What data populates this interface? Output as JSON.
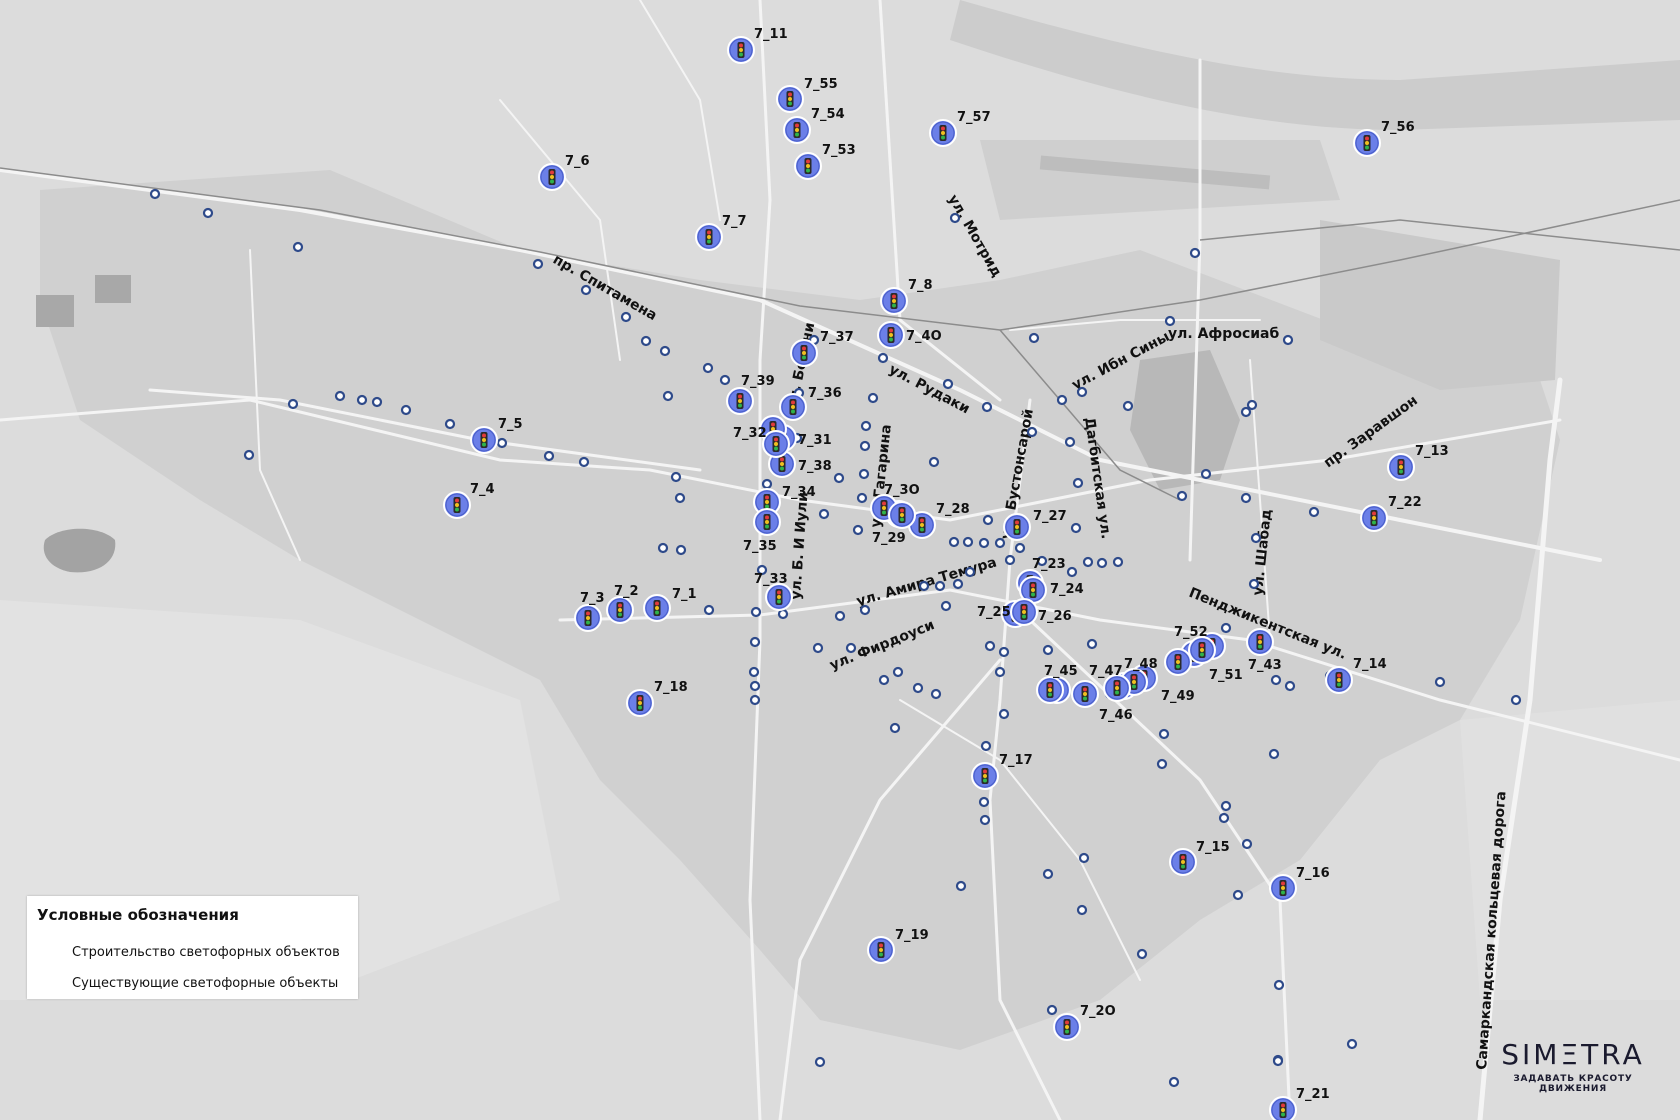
{
  "legend": {
    "title": "Условные обозначения",
    "new_label": "Строительство светофорных объектов",
    "existing_label": "Существующие светофорные объекты"
  },
  "logo": {
    "main": "SIMΞTRA",
    "tagline": "ЗАДАВАТЬ КРАСОТУ ДВИЖЕНИЯ"
  },
  "colors": {
    "new_marker": "#6b7fe8",
    "existing_marker": "#2e4a8a",
    "roads": "#ffffff",
    "background": "#dcdcdc"
  },
  "streets": [
    {
      "id": "spitamena",
      "name": "пр. Спитамена"
    },
    {
      "id": "motrid",
      "name": "ул. Мотрид"
    },
    {
      "id": "beruni",
      "name": "ул. Беруни"
    },
    {
      "id": "rudaki",
      "name": "ул. Рудаки"
    },
    {
      "id": "ibnsiny",
      "name": "ул. Ибн Сины"
    },
    {
      "id": "afrosiab",
      "name": "ул. Афросиаб"
    },
    {
      "id": "zarafshon",
      "name": "пр. Заравшон"
    },
    {
      "id": "gagarina",
      "name": "ул. Гагарина"
    },
    {
      "id": "bustonsaroy",
      "name": "ул. Бустонсарой"
    },
    {
      "id": "dagbitskaya",
      "name": "Дагбитская ул."
    },
    {
      "id": "b9iyuli",
      "name": "ул. Б. И Иули"
    },
    {
      "id": "amiratemura",
      "name": "ул. Амира Темура"
    },
    {
      "id": "firdousi",
      "name": "ул. Фирдоуси"
    },
    {
      "id": "shabad",
      "name": "ул. Шабад"
    },
    {
      "id": "pendzhikent",
      "name": "Пенджикентская ул."
    },
    {
      "id": "ring",
      "name": "Самаркандская кольцевая дорога"
    }
  ],
  "new_objects": [
    {
      "id": "7_1",
      "label": "7_1"
    },
    {
      "id": "7_2",
      "label": "7_2"
    },
    {
      "id": "7_3",
      "label": "7_3"
    },
    {
      "id": "7_4",
      "label": "7_4"
    },
    {
      "id": "7_5",
      "label": "7_5"
    },
    {
      "id": "7_6",
      "label": "7_6"
    },
    {
      "id": "7_7",
      "label": "7_7"
    },
    {
      "id": "7_8",
      "label": "7_8"
    },
    {
      "id": "7_11",
      "label": "7_11"
    },
    {
      "id": "7_13",
      "label": "7_13"
    },
    {
      "id": "7_14",
      "label": "7_14"
    },
    {
      "id": "7_15",
      "label": "7_15"
    },
    {
      "id": "7_16",
      "label": "7_16"
    },
    {
      "id": "7_17",
      "label": "7_17"
    },
    {
      "id": "7_18",
      "label": "7_18"
    },
    {
      "id": "7_19",
      "label": "7_19"
    },
    {
      "id": "7_20",
      "label": "7_2О"
    },
    {
      "id": "7_21",
      "label": "7_21"
    },
    {
      "id": "7_22",
      "label": "7_22"
    },
    {
      "id": "7_23",
      "label": "7_23"
    },
    {
      "id": "7_24",
      "label": "7_24"
    },
    {
      "id": "7_25",
      "label": "7_25"
    },
    {
      "id": "7_26",
      "label": "7_26"
    },
    {
      "id": "7_27",
      "label": "7_27"
    },
    {
      "id": "7_28",
      "label": "7_28"
    },
    {
      "id": "7_29",
      "label": "7_29"
    },
    {
      "id": "7_30",
      "label": "7_3О"
    },
    {
      "id": "7_31",
      "label": "7_31"
    },
    {
      "id": "7_32",
      "label": "7_32"
    },
    {
      "id": "7_33",
      "label": "7_33"
    },
    {
      "id": "7_34",
      "label": "7_34"
    },
    {
      "id": "7_35",
      "label": "7_35"
    },
    {
      "id": "7_36",
      "label": "7_36"
    },
    {
      "id": "7_37",
      "label": "7_37"
    },
    {
      "id": "7_38",
      "label": "7_38"
    },
    {
      "id": "7_39",
      "label": "7_39"
    },
    {
      "id": "7_40",
      "label": "7_4О"
    },
    {
      "id": "7_43",
      "label": "7_43"
    },
    {
      "id": "7_45",
      "label": "7_45"
    },
    {
      "id": "7_46",
      "label": "7_46"
    },
    {
      "id": "7_47",
      "label": "7_47"
    },
    {
      "id": "7_48",
      "label": "7_48"
    },
    {
      "id": "7_49",
      "label": "7_49"
    },
    {
      "id": "7_51",
      "label": "7_51"
    },
    {
      "id": "7_52",
      "label": "7_52"
    },
    {
      "id": "7_53",
      "label": "7_53"
    },
    {
      "id": "7_54",
      "label": "7_54"
    },
    {
      "id": "7_55",
      "label": "7_55"
    },
    {
      "id": "7_56",
      "label": "7_56"
    },
    {
      "id": "7_57",
      "label": "7_57"
    }
  ]
}
